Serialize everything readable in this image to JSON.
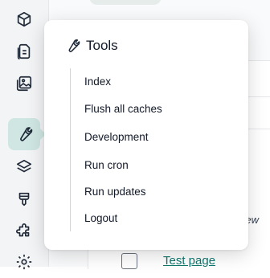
{
  "sidebar": {
    "items": [
      {
        "icon": "cube-icon"
      },
      {
        "icon": "documents-icon"
      },
      {
        "icon": "images-icon"
      },
      {
        "icon": "wrench-icon",
        "active": true
      },
      {
        "icon": "layers-icon"
      },
      {
        "icon": "paint-brush-icon"
      },
      {
        "icon": "puzzle-icon"
      },
      {
        "icon": "gear-icon"
      }
    ]
  },
  "background": {
    "view_label": "ew",
    "row_link": "Test page"
  },
  "popup": {
    "title": "Tools",
    "items": [
      {
        "label": "Index"
      },
      {
        "label": "Flush all caches"
      },
      {
        "label": "Development"
      },
      {
        "label": "Run cron"
      },
      {
        "label": "Run updates"
      },
      {
        "label": "Logout"
      }
    ]
  },
  "colors": {
    "active_bg": "#cfe6e2",
    "link": "#0f766e"
  }
}
